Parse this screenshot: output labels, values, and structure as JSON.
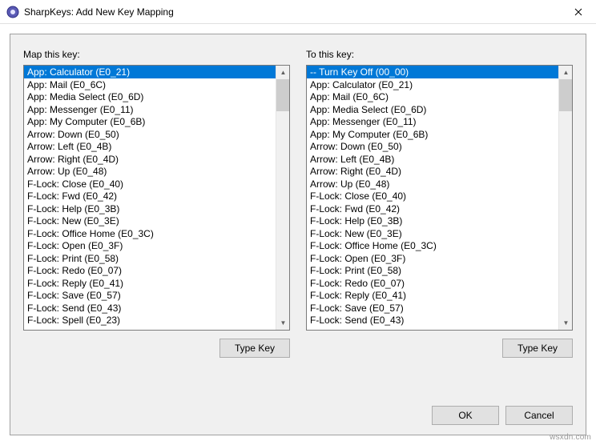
{
  "window": {
    "title": "SharpKeys: Add New Key Mapping",
    "close_tooltip": "Close"
  },
  "left": {
    "label": "Map this key:",
    "type_key_label": "Type Key",
    "selected_index": 0,
    "items": [
      "App: Calculator (E0_21)",
      "App: Mail (E0_6C)",
      "App: Media Select (E0_6D)",
      "App: Messenger (E0_11)",
      "App: My Computer (E0_6B)",
      "Arrow: Down (E0_50)",
      "Arrow: Left (E0_4B)",
      "Arrow: Right (E0_4D)",
      "Arrow: Up (E0_48)",
      "F-Lock: Close (E0_40)",
      "F-Lock: Fwd (E0_42)",
      "F-Lock: Help (E0_3B)",
      "F-Lock: New (E0_3E)",
      "F-Lock: Office Home (E0_3C)",
      "F-Lock: Open (E0_3F)",
      "F-Lock: Print (E0_58)",
      "F-Lock: Redo (E0_07)",
      "F-Lock: Reply (E0_41)",
      "F-Lock: Save (E0_57)",
      "F-Lock: Send (E0_43)",
      "F-Lock: Spell (E0_23)"
    ]
  },
  "right": {
    "label": "To this key:",
    "type_key_label": "Type Key",
    "selected_index": 0,
    "items": [
      "-- Turn Key Off (00_00)",
      "App: Calculator (E0_21)",
      "App: Mail (E0_6C)",
      "App: Media Select (E0_6D)",
      "App: Messenger (E0_11)",
      "App: My Computer (E0_6B)",
      "Arrow: Down (E0_50)",
      "Arrow: Left (E0_4B)",
      "Arrow: Right (E0_4D)",
      "Arrow: Up (E0_48)",
      "F-Lock: Close (E0_40)",
      "F-Lock: Fwd (E0_42)",
      "F-Lock: Help (E0_3B)",
      "F-Lock: New (E0_3E)",
      "F-Lock: Office Home (E0_3C)",
      "F-Lock: Open (E0_3F)",
      "F-Lock: Print (E0_58)",
      "F-Lock: Redo (E0_07)",
      "F-Lock: Reply (E0_41)",
      "F-Lock: Save (E0_57)",
      "F-Lock: Send (E0_43)"
    ]
  },
  "footer": {
    "ok_label": "OK",
    "cancel_label": "Cancel"
  },
  "watermark": "wsxdn.com"
}
